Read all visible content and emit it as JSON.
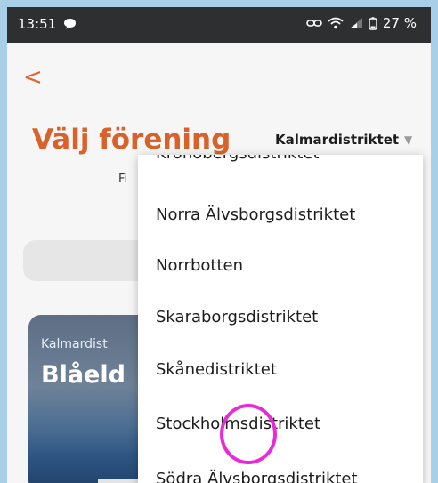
{
  "status_bar": {
    "time": "13:51",
    "battery": "27 %"
  },
  "header": {
    "back_symbol": "<",
    "title": "Välj förening",
    "district_select": {
      "selected": "Kalmardistriktet"
    },
    "sub_text": "Fi"
  },
  "search": {
    "placeholder": ""
  },
  "card": {
    "district": "Kalmardist",
    "name": "Blåeld"
  },
  "dropdown": {
    "items": [
      {
        "label": "Kronobergsdistriktet"
      },
      {
        "label": "Norra Älvsborgsdistriktet"
      },
      {
        "label": "Norrbotten"
      },
      {
        "label": "Skaraborgsdistriktet"
      },
      {
        "label": "Skånedistriktet"
      },
      {
        "label": "Stockholmsdistriktet"
      },
      {
        "label": "Södra Älvsborgsdistriktet"
      }
    ]
  },
  "colors": {
    "accent": "#d9622b",
    "highlight": "#e82ad8"
  }
}
